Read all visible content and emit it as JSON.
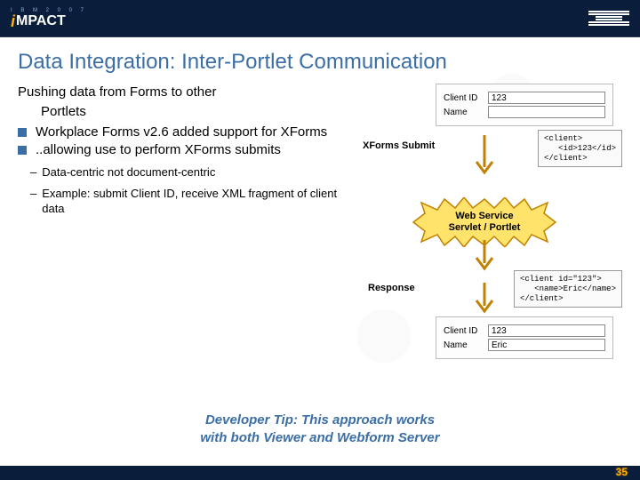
{
  "header": {
    "event_top": "I B M 2 0 0 7",
    "event_name": "IMPACT"
  },
  "title": "Data Integration: Inter-Portlet Communication",
  "body": {
    "lead": "Pushing data from Forms to other",
    "lead_cont": "Portlets",
    "bullets": [
      "Workplace Forms v2.6 added support for XForms",
      "..allowing use to perform XForms submits"
    ],
    "subs": [
      "Data-centric not document-centric",
      "Example: submit Client ID, receive XML fragment of client data"
    ]
  },
  "diagram": {
    "xforms_submit": "XForms Submit",
    "response": "Response",
    "starburst_l1": "Web Service",
    "starburst_l2": "Servlet / Portlet",
    "form1": {
      "client_id_label": "Client ID",
      "client_id_value": "123",
      "name_label": "Name",
      "name_value": ""
    },
    "form2": {
      "client_id_label": "Client ID",
      "client_id_value": "123",
      "name_label": "Name",
      "name_value": "Eric"
    },
    "xml1": "<client>\n   <id>123</id>\n</client>",
    "xml2": "<client id=\"123\">\n   <name>Eric</name>\n</client>"
  },
  "devtip_l1": "Developer Tip: This approach works",
  "devtip_l2": "with both Viewer and Webform Server",
  "page_number": "35"
}
